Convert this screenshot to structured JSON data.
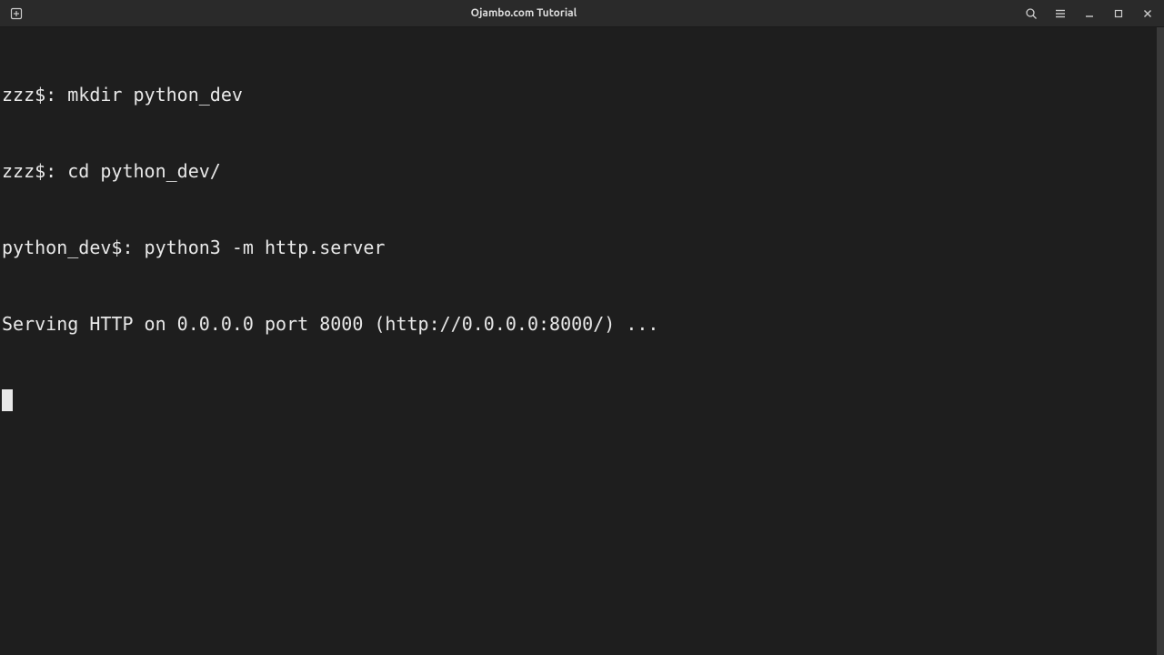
{
  "window": {
    "title": "Ojambo.com Tutorial"
  },
  "terminal": {
    "lines": [
      "zzz$: mkdir python_dev",
      "zzz$: cd python_dev/",
      "python_dev$: python3 -m http.server",
      "Serving HTTP on 0.0.0.0 port 8000 (http://0.0.0.0:8000/) ..."
    ]
  }
}
